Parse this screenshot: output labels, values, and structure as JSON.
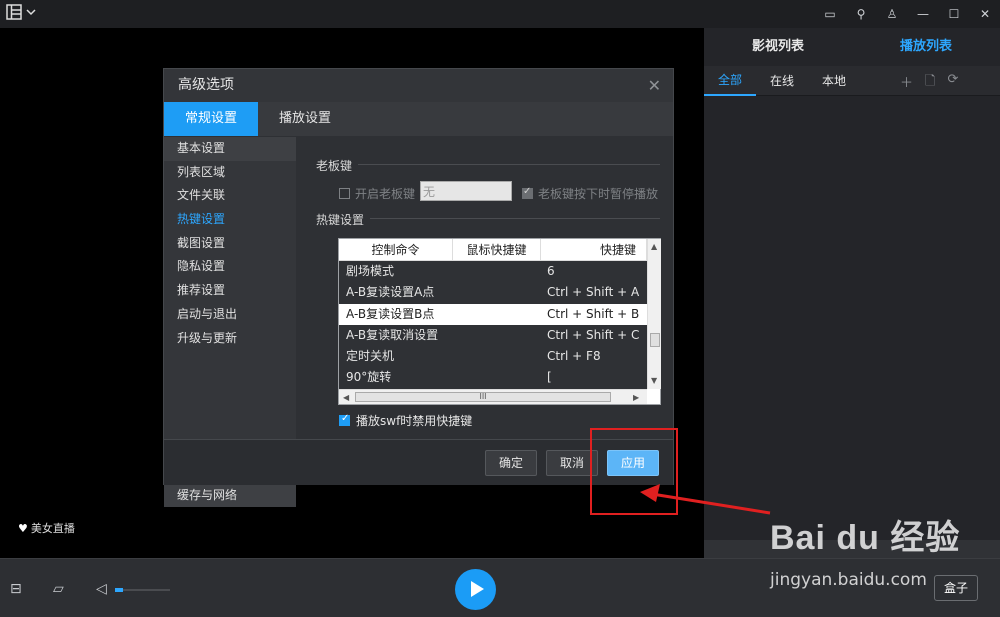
{
  "titlebar": {
    "icons": [
      "layout-icon",
      "chevron-down-icon",
      "message-icon",
      "pin-icon",
      "shirt-icon",
      "minimize-icon",
      "maximize-icon",
      "close-icon"
    ]
  },
  "right_panel": {
    "tabs": [
      {
        "label": "影视列表",
        "active": false
      },
      {
        "label": "播放列表",
        "active": true
      }
    ],
    "subtabs": [
      {
        "label": "全部",
        "active": true
      },
      {
        "label": "在线",
        "active": false
      },
      {
        "label": "本地",
        "active": false
      }
    ]
  },
  "video": {
    "live_label": "美女直播"
  },
  "controls": {
    "box_label": "盒子",
    "volume_level": 0.15
  },
  "watermark": {
    "brand": "Bai du 经验",
    "url": "jingyan.baidu.com"
  },
  "dialog": {
    "title": "高级选项",
    "close_glyph": "✕",
    "tabs": [
      {
        "label": "常规设置",
        "active": true
      },
      {
        "label": "播放设置",
        "active": false
      }
    ],
    "sidebar": [
      "基本设置",
      "列表区域",
      "文件关联",
      "热键设置",
      "截图设置",
      "隐私设置",
      "推荐设置",
      "启动与退出",
      "升级与更新"
    ],
    "sidebar_bottom": "缓存与网络",
    "boss_key": {
      "section": "老板键",
      "enable_label": "开启老板键",
      "enabled": false,
      "input_value": "无",
      "pause_label": "老板键按下时暂停播放",
      "pause_checked": true
    },
    "hotkeys": {
      "section": "热键设置",
      "columns": [
        "控制命令",
        "鼠标快捷键",
        "快捷键"
      ],
      "rows": [
        {
          "command": "剧场模式",
          "key": "6",
          "selected": false
        },
        {
          "command": "A-B复读设置A点",
          "key": "Ctrl + Shift + A",
          "selected": false
        },
        {
          "command": "A-B复读设置B点",
          "key": "Ctrl + Shift + B",
          "selected": true
        },
        {
          "command": "A-B复读取消设置",
          "key": "Ctrl + Shift + C",
          "selected": false
        },
        {
          "command": "定时关机",
          "key": "Ctrl + F8",
          "selected": false
        },
        {
          "command": "90°旋转",
          "key": "[",
          "selected": false
        }
      ],
      "scroll_glyph": "III"
    },
    "swf_option": {
      "label": "播放swf时禁用快捷键",
      "checked": true
    },
    "buttons": {
      "ok": "确定",
      "cancel": "取消",
      "apply": "应用"
    }
  }
}
